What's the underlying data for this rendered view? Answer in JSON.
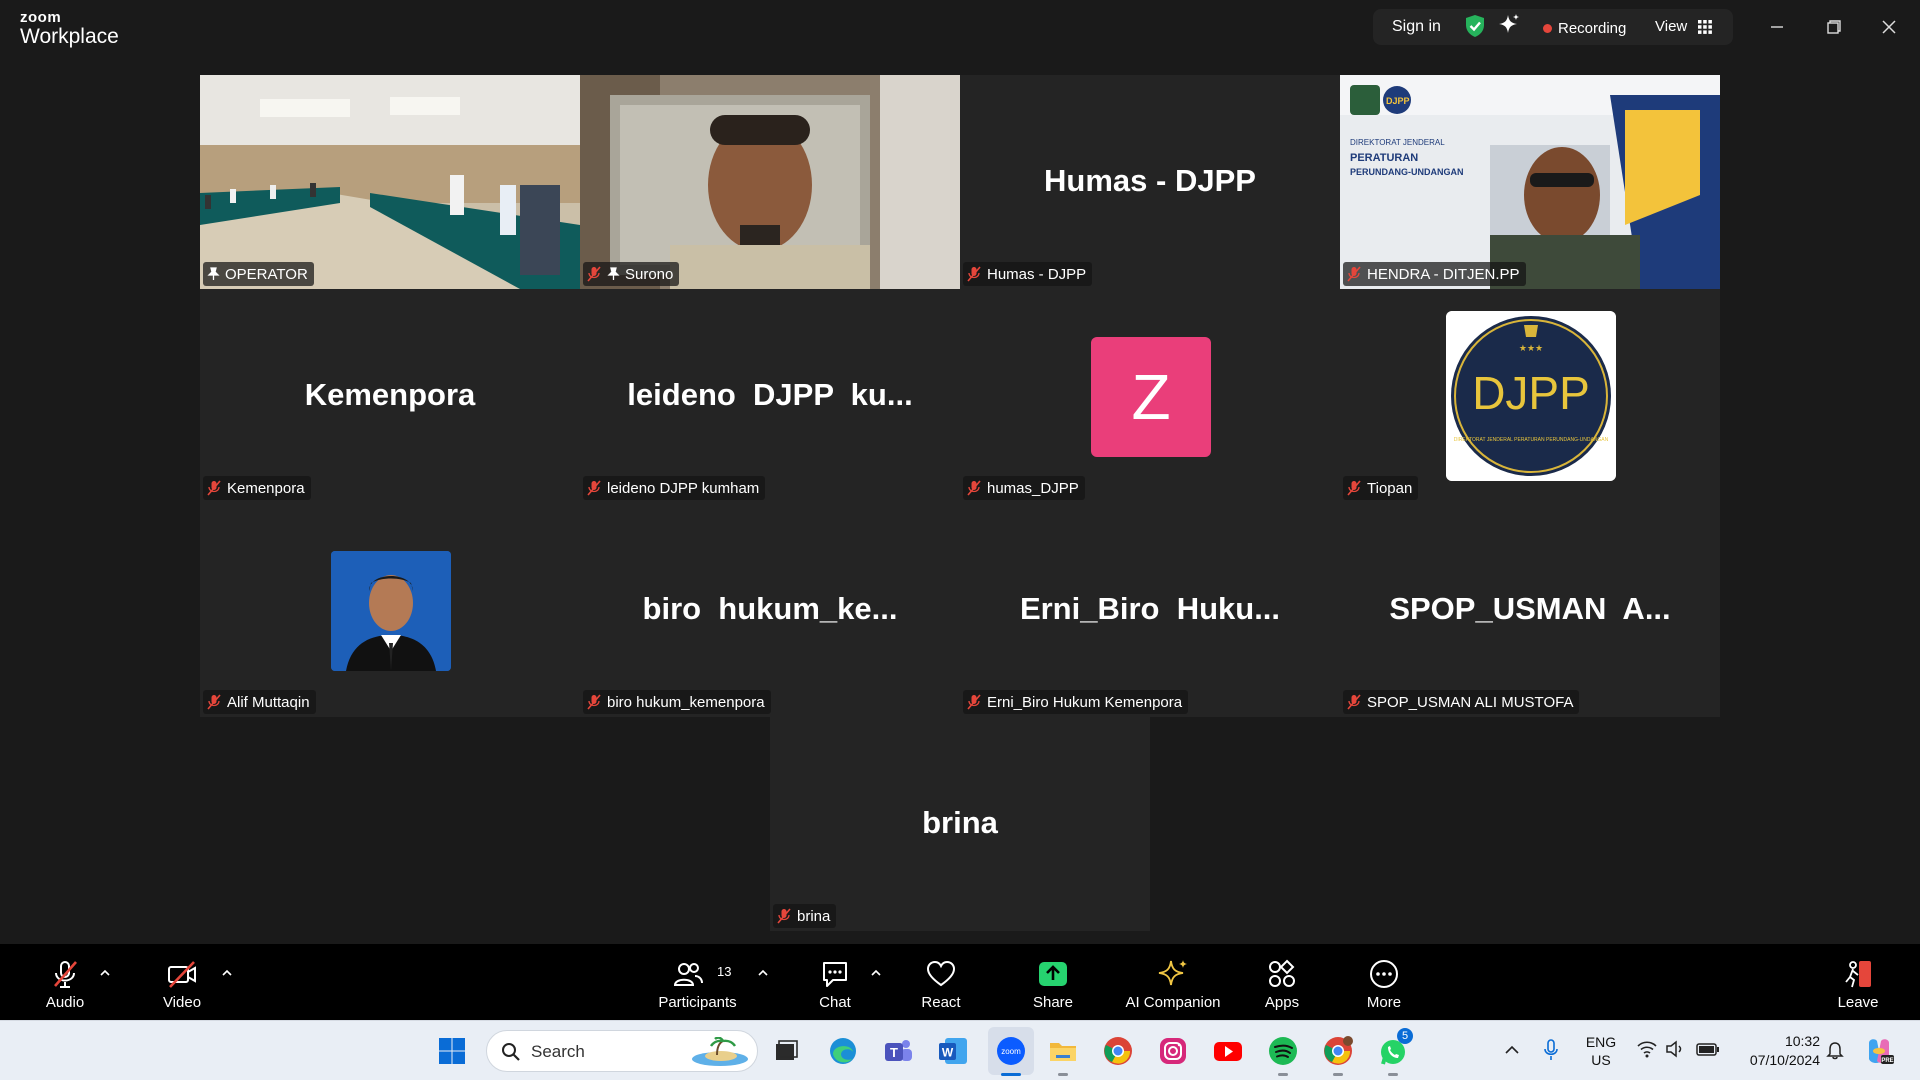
{
  "titlebar": {
    "brand_small": "zoom",
    "brand_big": "Workplace",
    "signin": "Sign in",
    "recording": "Recording",
    "view": "View",
    "icons": [
      "shield-check-icon",
      "sparkle-icon",
      "grid-icon",
      "minimize-icon",
      "restore-icon",
      "close-icon"
    ]
  },
  "tiles": [
    {
      "label": "OPERATOR",
      "pinned": true,
      "active": true,
      "kind": "video"
    },
    {
      "label": "Surono",
      "pinned": true,
      "kind": "video"
    },
    {
      "label": "Humas - DJPP",
      "big": "Humas - DJPP",
      "kind": "name"
    },
    {
      "label": "HENDRA - DITJEN.PP",
      "kind": "video"
    },
    {
      "label": "Kemenpora",
      "big": "Kemenpora",
      "kind": "name"
    },
    {
      "label": "leideno DJPP kumham",
      "big": "leideno  DJPP  ku...",
      "kind": "name"
    },
    {
      "label": "humas_DJPP",
      "avatar_letter": "Z",
      "kind": "avatar"
    },
    {
      "label": "Tiopan",
      "logo_text": "DJPP",
      "logo_sub": "DIREKTORAT JENDERAL PERATURAN PERUNDANG-UNDANGAN",
      "kind": "logo"
    },
    {
      "label": "Alif Muttaqin",
      "kind": "photo"
    },
    {
      "label": "biro hukum_kemenpora",
      "big": "biro  hukum_ke...",
      "kind": "name"
    },
    {
      "label": "Erni_Biro Hukum Kemenpora",
      "big": "Erni_Biro  Huku...",
      "kind": "name"
    },
    {
      "label": "SPOP_USMAN ALI MUSTOFA",
      "big": "SPOP_USMAN  A...",
      "kind": "name"
    },
    {
      "label": "brina",
      "big": "brina",
      "kind": "name"
    }
  ],
  "hendra_banner": {
    "line1": "DJPP",
    "line2": "DIREKTORAT JENDERAL",
    "line3": "PERATURAN",
    "line4": "PERUNDANG-UNDANGAN"
  },
  "toolbar": {
    "audio": "Audio",
    "video": "Video",
    "participants": "Participants",
    "participants_count": "13",
    "chat": "Chat",
    "react": "React",
    "share": "Share",
    "ai": "AI Companion",
    "apps": "Apps",
    "more": "More",
    "leave": "Leave",
    "colors": {
      "share": "#26d36f",
      "leave": "#e5463b",
      "ai": "#f2c744"
    }
  },
  "taskbar": {
    "search_placeholder": "Search",
    "lang1": "ENG",
    "lang2": "US",
    "time": "10:32",
    "date": "07/10/2024",
    "whatsapp_badge": "5",
    "apps": [
      "windows-start-icon",
      "task-view-icon",
      "edge-icon",
      "teams-icon",
      "word-icon",
      "zoom-icon",
      "file-explorer-icon",
      "chrome-icon",
      "instagram-icon",
      "youtube-icon",
      "spotify-icon",
      "chrome-profile-icon",
      "whatsapp-icon"
    ]
  }
}
